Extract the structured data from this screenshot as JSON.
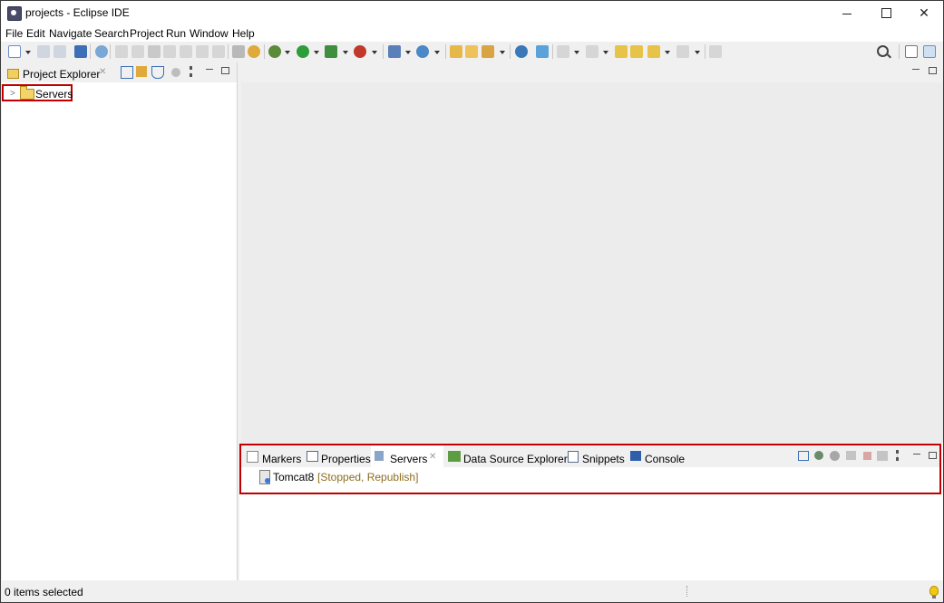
{
  "window": {
    "title": "projects - Eclipse IDE"
  },
  "menubar": {
    "items": [
      "File",
      "Edit",
      "Navigate",
      "Search",
      "Project",
      "Run",
      "Window",
      "Help"
    ]
  },
  "toolbar": {
    "icons": [
      "new-icon",
      "save-icon",
      "save-all-icon",
      "open-console-icon",
      "skip-breakpoints-icon",
      "resume-icon",
      "suspend-icon",
      "terminate-icon",
      "disconnect-icon",
      "step-into-icon",
      "step-over-icon",
      "step-return-icon",
      "use-step-filters-icon",
      "debug-icon",
      "run-icon",
      "coverage-icon",
      "external-tools-icon",
      "new-server-icon",
      "new-web-service-icon",
      "open-type-icon",
      "open-task-icon",
      "search-globe-icon",
      "annotation-next-icon",
      "annotation-prev-icon",
      "last-edit-icon",
      "back-icon",
      "forward-icon",
      "pin-editor-icon",
      "search-icon",
      "open-perspective-icon",
      "java-ee-perspective-icon"
    ]
  },
  "project_explorer": {
    "tab_label": "Project Explorer",
    "tree": [
      {
        "label": "Servers",
        "expanded": false
      }
    ]
  },
  "bottom_panel": {
    "tabs": [
      {
        "label": "Markers",
        "icon": "markers-icon",
        "active": false
      },
      {
        "label": "Properties",
        "icon": "properties-icon",
        "active": false
      },
      {
        "label": "Servers",
        "icon": "servers-icon",
        "active": true
      },
      {
        "label": "Data Source Explorer",
        "icon": "data-source-icon",
        "active": false
      },
      {
        "label": "Snippets",
        "icon": "snippets-icon",
        "active": false
      },
      {
        "label": "Console",
        "icon": "console-icon",
        "active": false
      }
    ],
    "servers": [
      {
        "name": "Tomcat8",
        "state": "[Stopped, Republish]"
      }
    ]
  },
  "statusbar": {
    "text": "0 items selected"
  },
  "colors": {
    "highlight_box": "#c00000",
    "server_state": "#8c6d1f",
    "background": "#f0f0f0"
  }
}
